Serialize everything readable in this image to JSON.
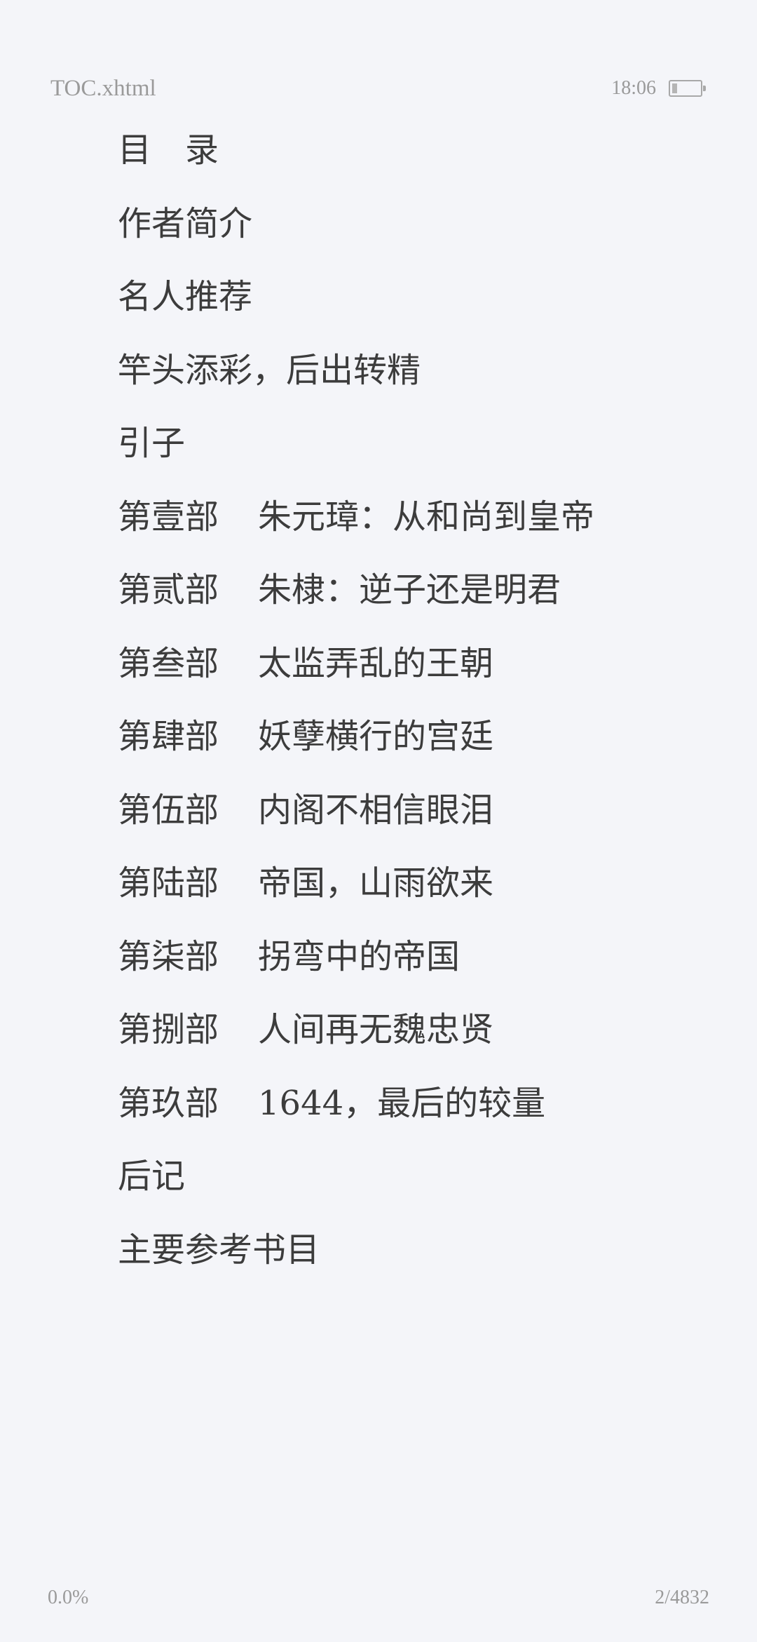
{
  "header": {
    "filename": "TOC.xhtml",
    "time": "18:06",
    "battery_level": 0.2
  },
  "toc": {
    "items": [
      {
        "part": "",
        "title": "目　录"
      },
      {
        "part": "",
        "title": "作者简介"
      },
      {
        "part": "",
        "title": "名人推荐"
      },
      {
        "part": "",
        "title": "竿头添彩，后出转精"
      },
      {
        "part": "",
        "title": "引子"
      },
      {
        "part": "第壹部",
        "title": "朱元璋：从和尚到皇帝"
      },
      {
        "part": "第贰部",
        "title": "朱棣：逆子还是明君"
      },
      {
        "part": "第叁部",
        "title": "太监弄乱的王朝"
      },
      {
        "part": "第肆部",
        "title": "妖孽横行的宫廷"
      },
      {
        "part": "第伍部",
        "title": "内阁不相信眼泪"
      },
      {
        "part": "第陆部",
        "title": "帝国，山雨欲来"
      },
      {
        "part": "第柒部",
        "title": "拐弯中的帝国"
      },
      {
        "part": "第捌部",
        "title": "人间再无魏忠贤"
      },
      {
        "part": "第玖部",
        "title": "1644，最后的较量"
      },
      {
        "part": "",
        "title": "后记"
      },
      {
        "part": "",
        "title": "主要参考书目"
      }
    ]
  },
  "footer": {
    "progress": "0.0%",
    "page": "2/4832"
  }
}
